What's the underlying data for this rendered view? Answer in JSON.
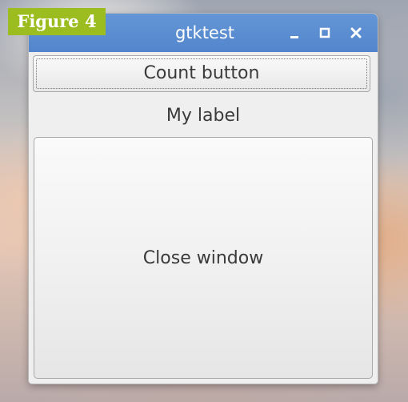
{
  "figure_badge": "Figure 4",
  "window": {
    "title": "gtktest",
    "controls": {
      "minimize_icon": "minimize-icon",
      "maximize_icon": "maximize-icon",
      "close_icon": "close-icon"
    }
  },
  "content": {
    "count_button_label": "Count button",
    "label_text": "My label",
    "close_button_label": "Close window"
  },
  "colors": {
    "titlebar": "#5a8dd2",
    "badge": "#9cbd1f",
    "window_bg": "#efefef"
  }
}
